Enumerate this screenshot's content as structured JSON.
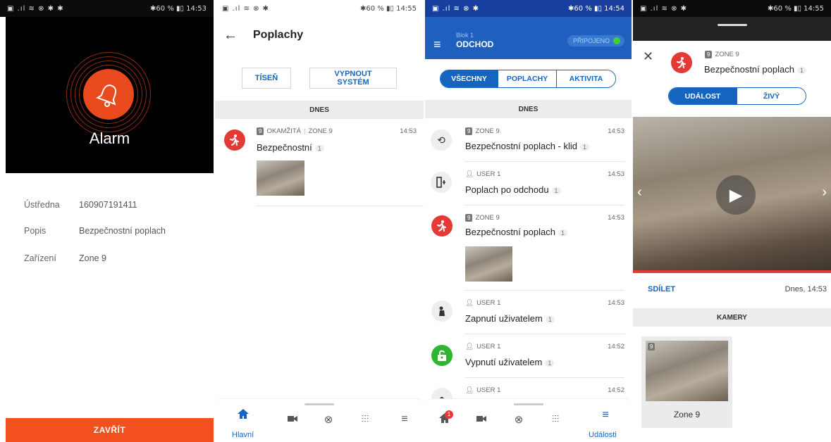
{
  "screen1": {
    "status": {
      "left": "▣ .ıl ≋ ⊗ ✱ ✱",
      "right": "✱60 % ▮▯ 14:53"
    },
    "alarm_title": "Alarm",
    "rows": [
      {
        "key": "Ústředna",
        "value": "160907191411"
      },
      {
        "key": "Popis",
        "value": "Bezpečnostní poplach"
      },
      {
        "key": "Zařízení",
        "value": "Zone 9"
      }
    ],
    "close_label": "ZAVŘÍT"
  },
  "screen2": {
    "status": {
      "left": "▣ .ıl ≋ ⊗ ✱",
      "right": "✱60 % ▮▯ 14:55"
    },
    "title": "Poplachy",
    "btn_panic": "TÍSEŇ",
    "btn_off_line1": "VYPNOUT",
    "btn_off_line2": "SYSTÉM",
    "section": "DNES",
    "event": {
      "zone_num": "9",
      "type": "OKAMŽITÁ",
      "zone": "ZONE 9",
      "time": "14:53",
      "text": "Bezpečnostní",
      "count": "1"
    },
    "nav": {
      "home_label": "Hlavní"
    }
  },
  "screen3": {
    "status": {
      "left": "▣ .ıl ≋ ⊗ ✱",
      "right": "✱60 % ▮▯ 14:54"
    },
    "blok": "Blok 1",
    "mode": "ODCHOD",
    "connection": "PŘIPOJENO",
    "tabs": [
      "VŠECHNY",
      "POPLACHY",
      "AKTIVITA"
    ],
    "section": "DNES",
    "events": [
      {
        "meta": "ZONE 9",
        "zone_num": "9",
        "time": "14:53",
        "text": "Bezpečnostní poplach - klid",
        "count": "1"
      },
      {
        "meta": "USER 1",
        "time": "14:53",
        "text": "Poplach po odchodu",
        "count": "1"
      },
      {
        "meta": "ZONE 9",
        "zone_num": "9",
        "time": "14:53",
        "text": "Bezpečnostní poplach",
        "count": "1"
      },
      {
        "meta": "USER 1",
        "time": "14:53",
        "text": "Zapnutí uživatelem",
        "count": "1"
      },
      {
        "meta": "USER 1",
        "time": "14:52",
        "text": "Vypnutí uživatelem",
        "count": "1"
      },
      {
        "meta": "USER 1",
        "time": "14:52"
      }
    ],
    "nav": {
      "home_badge": "1",
      "events_label": "Události"
    }
  },
  "screen4": {
    "status": {
      "left": "▣ .ıl ≋ ⊗ ✱",
      "right": "✱60 % ▮▯ 14:55"
    },
    "zone_num": "9",
    "zone": "ZONE 9",
    "title": "Bezpečnostní poplach",
    "count": "1",
    "tabs": [
      "UDÁLOST",
      "ŽIVÝ"
    ],
    "share": "SDÍLET",
    "datetime": "Dnes, 14:53",
    "cameras_header": "KAMERY",
    "camera": {
      "num": "9",
      "name": "Zone 9"
    }
  }
}
